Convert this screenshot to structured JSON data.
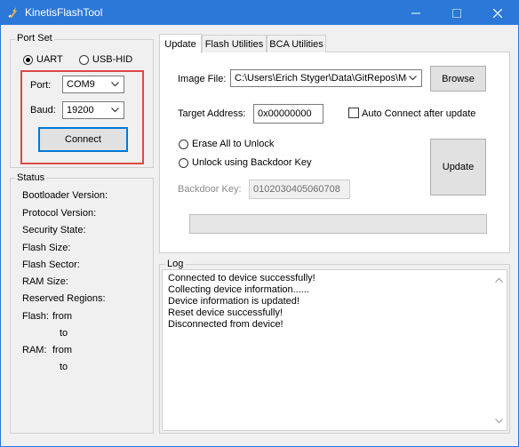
{
  "window": {
    "title": "KinetisFlashTool",
    "accent": "#2b78d8",
    "icons": {
      "app": "lightning-wrench-icon",
      "minimize": "minimize-icon",
      "maximize": "maximize-icon",
      "close": "close-icon"
    }
  },
  "port_set": {
    "title": "Port Set",
    "uart_label": "UART",
    "usbhid_label": "USB-HID",
    "selected": "UART",
    "port_label": "Port:",
    "port_value": "COM9",
    "baud_label": "Baud:",
    "baud_value": "19200",
    "connect_label": "Connect",
    "highlight_color": "#e04848"
  },
  "status": {
    "title": "Status",
    "bootloader_version": "Bootloader Version:",
    "protocol_version": "Protocol Version:",
    "security_state": "Security State:",
    "flash_size": "Flash Size:",
    "flash_sector": "Flash Sector:",
    "ram_size": "RAM Size:",
    "reserved_regions": "Reserved Regions:",
    "flash_label": "Flash:",
    "ram_label": "RAM:",
    "from_label": "from",
    "to_label": "to"
  },
  "tabs": [
    {
      "label": "Update",
      "active": true
    },
    {
      "label": "Flash Utilities",
      "active": false
    },
    {
      "label": "BCA Utilities",
      "active": false
    }
  ],
  "update_tab": {
    "image_file_label": "Image File:",
    "image_file_value": "C:\\Users\\Erich Styger\\Data\\GitRepos\\Mc",
    "browse_label": "Browse",
    "target_address_label": "Target Address:",
    "target_address_value": "0x00000000",
    "auto_connect_label": "Auto Connect after update",
    "auto_connect_checked": false,
    "erase_all_label": "Erase All to Unlock",
    "backdoor_unlock_label": "Unlock using Backdoor Key",
    "backdoor_key_label": "Backdoor Key:",
    "backdoor_key_value": "0102030405060708",
    "update_label": "Update",
    "progress_fraction": 0
  },
  "log": {
    "title": "Log",
    "lines": [
      "Connected to device successfully!",
      "Collecting device information......",
      "Device information is updated!",
      "Reset device successfully!",
      "Disconnected from device!"
    ]
  }
}
